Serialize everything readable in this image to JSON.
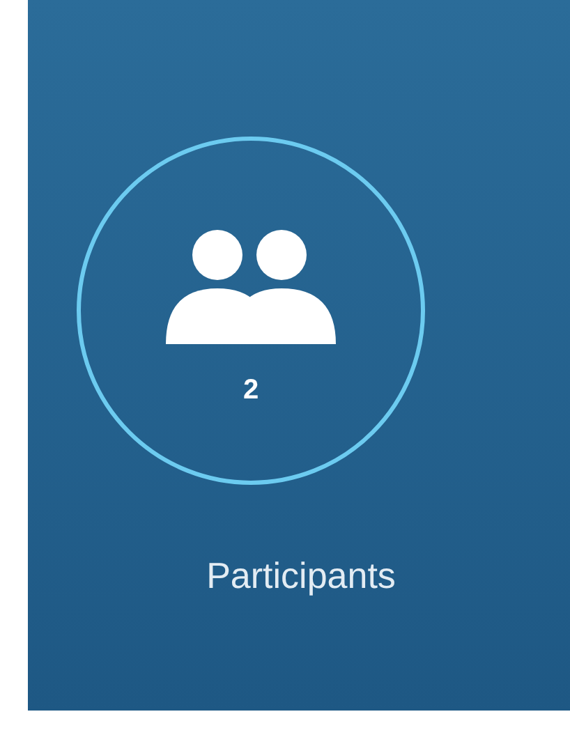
{
  "participants": {
    "count": "2",
    "label": "Participants"
  }
}
